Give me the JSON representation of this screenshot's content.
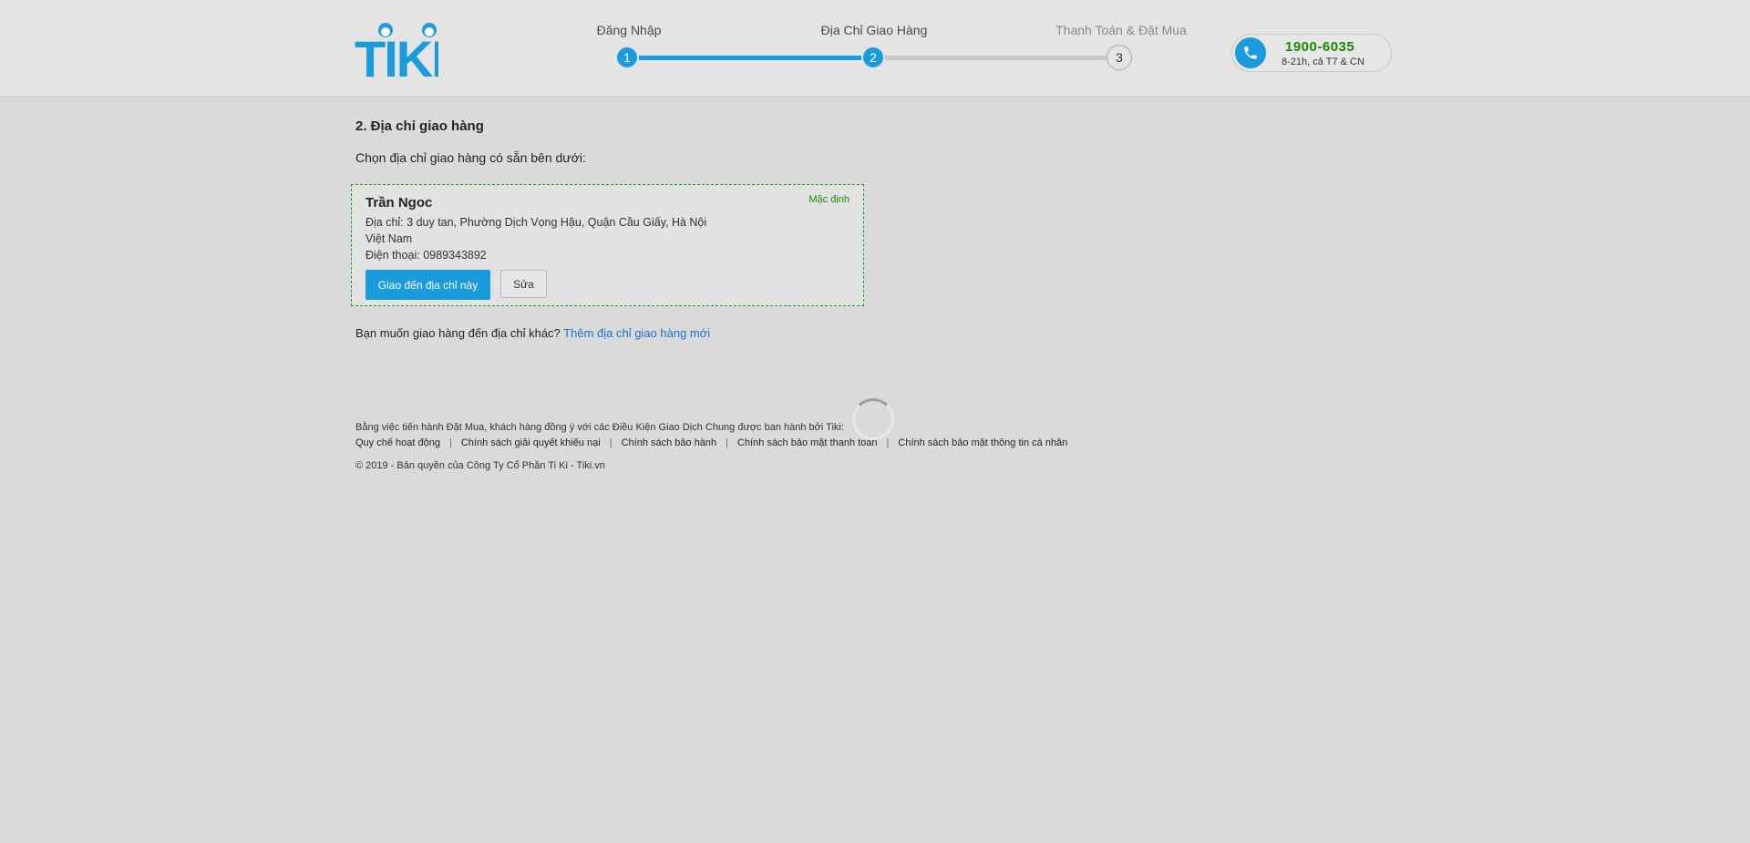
{
  "brand": {
    "logo_text": "TiKi",
    "color": "#1a9bdb"
  },
  "steps": [
    {
      "number": "1",
      "label": "Đăng Nhập",
      "state": "done"
    },
    {
      "number": "2",
      "label": "Địa Chỉ Giao Hàng",
      "state": "current"
    },
    {
      "number": "3",
      "label": "Thanh Toán & Đặt Mua",
      "state": "pending"
    }
  ],
  "progress": {
    "completed_fraction": 0.5
  },
  "hotline": {
    "icon": "phone-icon",
    "number": "1900-6035",
    "hours": "8-21h, cả T7 & CN"
  },
  "section": {
    "title": "2. Địa chỉ giao hàng",
    "subtitle": "Chọn địa chỉ giao hàng có sẵn bên dưới:"
  },
  "address": {
    "name": "Trần Ngoc",
    "default_badge": "Mặc định",
    "address_line": "Địa chỉ: 3 duy tan, Phường Dịch Vọng Hậu, Quận Cầu Giấy, Hà Nội",
    "country": "Việt Nam",
    "phone_line": "Điện thoại: 0989343892",
    "deliver_button": "Giao đến địa chỉ này",
    "edit_button": "Sửa"
  },
  "other_address": {
    "prompt": "Bạn muốn giao hàng đến địa chỉ khác?",
    "link": "Thêm địa chỉ giao hàng mới"
  },
  "footer": {
    "terms": "Bằng việc tiến hành Đặt Mua, khách hàng đồng ý với các Điều Kiện Giao Dịch Chung được ban hành bởi Tiki:",
    "links": [
      "Quy chế hoạt động",
      "Chính sách giải quyết khiếu nại",
      "Chính sách bảo hành",
      "Chính sách bảo mật thanh toán",
      "Chính sách bảo mật thông tin cá nhân"
    ],
    "copyright": "© 2019 - Bản quyền của Công Ty Cổ Phần Ti Ki - Tiki.vn"
  }
}
